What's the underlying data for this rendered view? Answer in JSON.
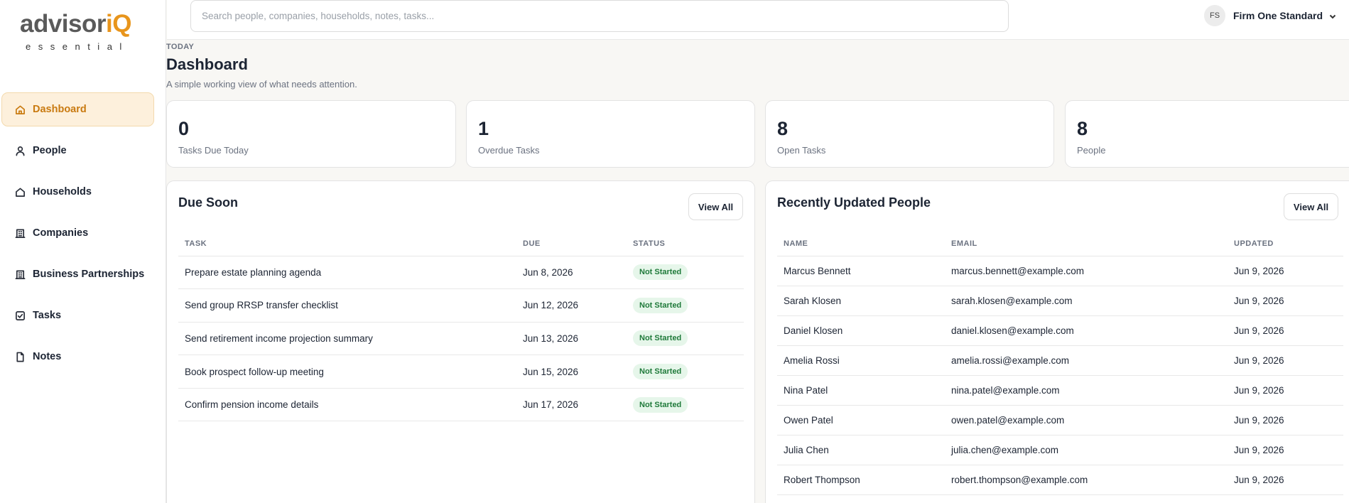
{
  "brand": {
    "logo_main": "advisor",
    "logo_accent": "iQ",
    "logo_sub": "essential"
  },
  "sidebar": {
    "items": [
      {
        "label": "Dashboard",
        "icon": "home-icon",
        "active": true
      },
      {
        "label": "People",
        "icon": "person-icon"
      },
      {
        "label": "Households",
        "icon": "house-icon"
      },
      {
        "label": "Companies",
        "icon": "building-icon"
      },
      {
        "label": "Business Partnerships",
        "icon": "building-icon"
      },
      {
        "label": "Tasks",
        "icon": "checkbox-icon"
      },
      {
        "label": "Notes",
        "icon": "document-icon"
      }
    ]
  },
  "topbar": {
    "search_placeholder": "Search people, companies, households, notes, tasks...",
    "avatar_initials": "FS",
    "account_name": "Firm One Standard"
  },
  "header": {
    "eyebrow": "TODAY",
    "title": "Dashboard",
    "subtitle": "A simple working view of what needs attention."
  },
  "stats": [
    {
      "value": "0",
      "label": "Tasks Due Today"
    },
    {
      "value": "1",
      "label": "Overdue Tasks"
    },
    {
      "value": "8",
      "label": "Open Tasks"
    },
    {
      "value": "8",
      "label": "People"
    }
  ],
  "due_soon": {
    "title": "Due Soon",
    "view_all": "View All",
    "columns": [
      "Task",
      "Due",
      "Status"
    ],
    "rows": [
      {
        "task": "Prepare estate planning agenda",
        "due": "Jun 8, 2026",
        "status": "Not Started"
      },
      {
        "task": "Send group RRSP transfer checklist",
        "due": "Jun 12, 2026",
        "status": "Not Started"
      },
      {
        "task": "Send retirement income projection summary",
        "due": "Jun 13, 2026",
        "status": "Not Started"
      },
      {
        "task": "Book prospect follow-up meeting",
        "due": "Jun 15, 2026",
        "status": "Not Started"
      },
      {
        "task": "Confirm pension income details",
        "due": "Jun 17, 2026",
        "status": "Not Started"
      }
    ]
  },
  "recent_people": {
    "title": "Recently Updated People",
    "view_all": "View All",
    "columns": [
      "Name",
      "Email",
      "Updated"
    ],
    "rows": [
      {
        "name": "Marcus Bennett",
        "email": "marcus.bennett@example.com",
        "updated": "Jun 9, 2026"
      },
      {
        "name": "Sarah Klosen",
        "email": "sarah.klosen@example.com",
        "updated": "Jun 9, 2026"
      },
      {
        "name": "Daniel Klosen",
        "email": "daniel.klosen@example.com",
        "updated": "Jun 9, 2026"
      },
      {
        "name": "Amelia Rossi",
        "email": "amelia.rossi@example.com",
        "updated": "Jun 9, 2026"
      },
      {
        "name": "Nina Patel",
        "email": "nina.patel@example.com",
        "updated": "Jun 9, 2026"
      },
      {
        "name": "Owen Patel",
        "email": "owen.patel@example.com",
        "updated": "Jun 9, 2026"
      },
      {
        "name": "Julia Chen",
        "email": "julia.chen@example.com",
        "updated": "Jun 9, 2026"
      },
      {
        "name": "Robert Thompson",
        "email": "robert.thompson@example.com",
        "updated": "Jun 9, 2026"
      }
    ]
  },
  "colors": {
    "accent": "#e8951c",
    "active_bg": "#fdf0dc",
    "badge_bg": "#e6f6ea",
    "badge_text": "#1f7a3a"
  }
}
